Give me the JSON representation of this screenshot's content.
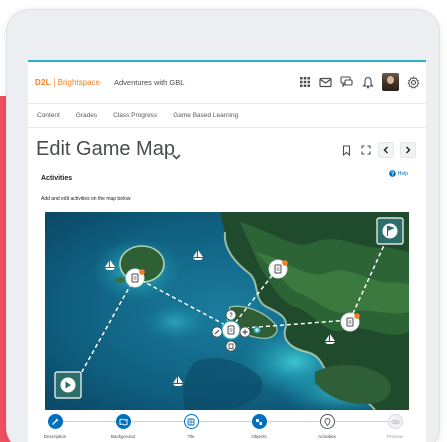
{
  "app": {
    "brand_d2l": "D2L",
    "brand_name": "Brightspace",
    "course_name": "Adventures with GBL",
    "accent_color": "#f47e20",
    "highlight_color": "#2bb0c4"
  },
  "nav": {
    "items": [
      "Content",
      "Grades",
      "Class Progress",
      "Game Based Learning"
    ]
  },
  "page": {
    "title": "Edit Game Map",
    "section_heading": "Activities",
    "help_label": "Help",
    "instructions": "Add and edit activities on the map below"
  },
  "top_icons": [
    "grid-icon",
    "mail-icon",
    "chat-icon",
    "bell-icon",
    "avatar",
    "gear-icon"
  ],
  "title_icons": [
    "bookmark-icon",
    "fullscreen-icon",
    "chevron-left-icon",
    "chevron-right-icon"
  ],
  "steps": [
    {
      "label": "Description",
      "state": "active",
      "icon": "pencil-icon"
    },
    {
      "label": "Background",
      "state": "active",
      "icon": "map-icon"
    },
    {
      "label": "Tile",
      "state": "inactive",
      "icon": "tile-icon"
    },
    {
      "label": "Objects",
      "state": "active",
      "icon": "objects-icon"
    },
    {
      "label": "Activities",
      "state": "inactive",
      "icon": "pin-icon"
    },
    {
      "label": "Preview",
      "state": "disabled",
      "icon": "eye-icon"
    }
  ]
}
